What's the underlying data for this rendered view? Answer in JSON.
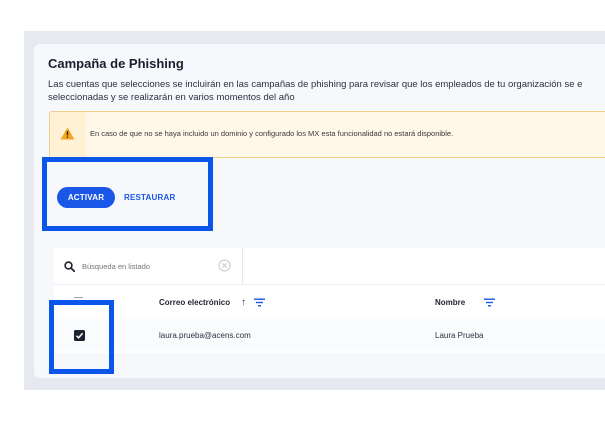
{
  "campaign": {
    "title": "Campaña de Phishing",
    "description_line1": "Las cuentas que selecciones se incluirán en las campañas de phishing para revisar que los empleados de tu organización se e",
    "description_line2": "seleccionadas y se realizarán en varios momentos del año"
  },
  "warning": {
    "icon": "warning-triangle-icon",
    "text": "En caso de que no se haya incluido un dominio y configurado los MX esta funcionalidad no estará disponible.",
    "color": "#f5a623"
  },
  "actions": {
    "activar_label": "ACTIVAR",
    "restaurar_label": "RESTAURAR",
    "accent": "#1a56e8"
  },
  "search": {
    "placeholder": "Búsqueda en listado"
  },
  "table": {
    "columns": {
      "email": "Correo electrónico",
      "nombre": "Nombre"
    },
    "rows": [
      {
        "email": "laura.prueba@acens.com",
        "nombre": "Laura Prueba",
        "checked": true
      }
    ]
  },
  "highlight_color": "#0a55ea"
}
